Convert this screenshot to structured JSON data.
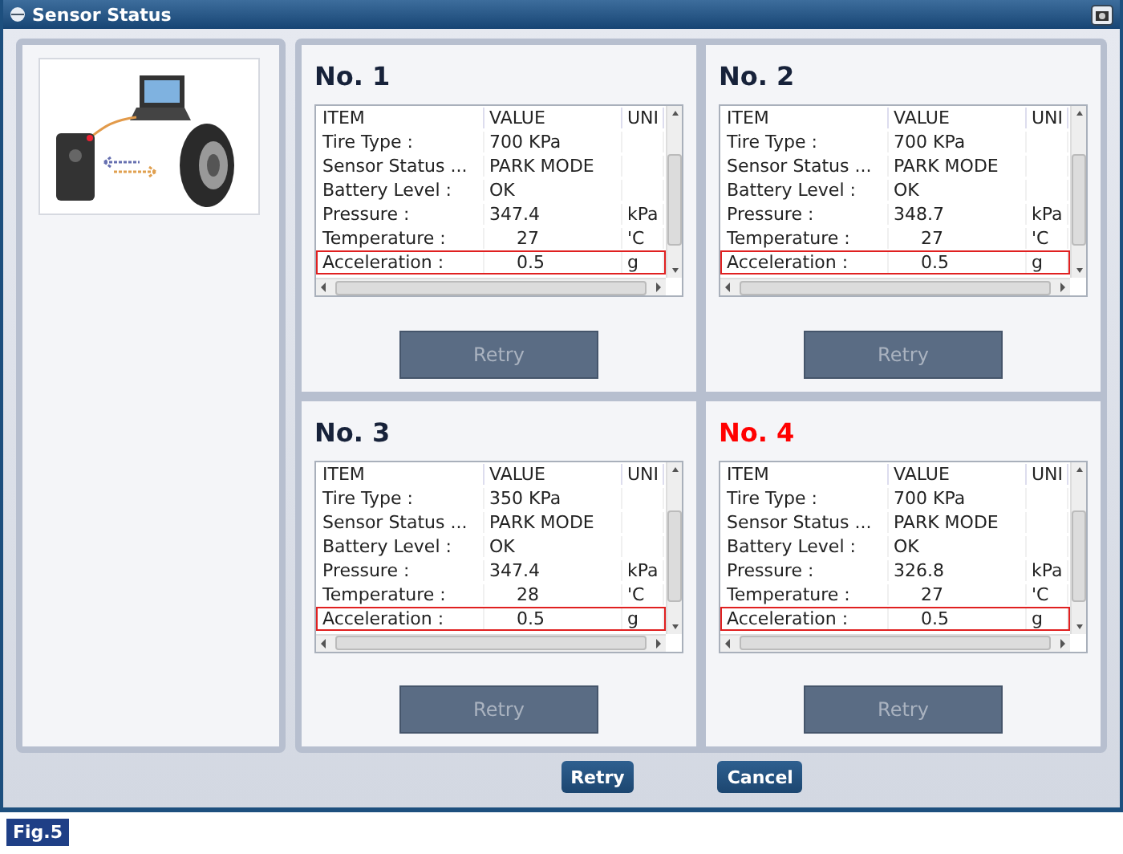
{
  "window": {
    "title": "Sensor Status"
  },
  "sensors": [
    {
      "title": "No. 1",
      "alert": false,
      "columns": [
        "ITEM",
        "VALUE",
        "UNI"
      ],
      "rows": [
        {
          "item": "Tire Type :",
          "value": "700 KPa",
          "unit": "",
          "highlighted": false
        },
        {
          "item": "Sensor Status ...",
          "value": "PARK MODE",
          "unit": "",
          "highlighted": false
        },
        {
          "item": "Battery Level :",
          "value": "OK",
          "unit": "",
          "highlighted": false
        },
        {
          "item": "Pressure :",
          "value": "347.4",
          "unit": "kPa",
          "highlighted": false
        },
        {
          "item": "Temperature :",
          "value": "27",
          "unit": "'C",
          "highlighted": false
        },
        {
          "item": "Acceleration :",
          "value": "0.5",
          "unit": "g",
          "highlighted": true
        }
      ],
      "button": {
        "label": "Retry",
        "disabled": true
      }
    },
    {
      "title": "No. 2",
      "alert": false,
      "columns": [
        "ITEM",
        "VALUE",
        "UNI"
      ],
      "rows": [
        {
          "item": "Tire Type :",
          "value": "700 KPa",
          "unit": "",
          "highlighted": false
        },
        {
          "item": "Sensor Status ...",
          "value": "PARK MODE",
          "unit": "",
          "highlighted": false
        },
        {
          "item": "Battery Level :",
          "value": "OK",
          "unit": "",
          "highlighted": false
        },
        {
          "item": "Pressure :",
          "value": "348.7",
          "unit": "kPa",
          "highlighted": false
        },
        {
          "item": "Temperature :",
          "value": "27",
          "unit": "'C",
          "highlighted": false
        },
        {
          "item": "Acceleration :",
          "value": "0.5",
          "unit": "g",
          "highlighted": true
        }
      ],
      "button": {
        "label": "Retry",
        "disabled": true
      }
    },
    {
      "title": "No. 3",
      "alert": false,
      "columns": [
        "ITEM",
        "VALUE",
        "UNI"
      ],
      "rows": [
        {
          "item": "Tire Type :",
          "value": "350 KPa",
          "unit": "",
          "highlighted": false
        },
        {
          "item": "Sensor Status ...",
          "value": "PARK MODE",
          "unit": "",
          "highlighted": false
        },
        {
          "item": "Battery Level :",
          "value": "OK",
          "unit": "",
          "highlighted": false
        },
        {
          "item": "Pressure :",
          "value": "347.4",
          "unit": "kPa",
          "highlighted": false
        },
        {
          "item": "Temperature :",
          "value": "28",
          "unit": "'C",
          "highlighted": false
        },
        {
          "item": "Acceleration :",
          "value": "0.5",
          "unit": "g",
          "highlighted": true
        }
      ],
      "button": {
        "label": "Retry",
        "disabled": true
      }
    },
    {
      "title": "No. 4",
      "alert": true,
      "columns": [
        "ITEM",
        "VALUE",
        "UNI"
      ],
      "rows": [
        {
          "item": "Tire Type :",
          "value": "700 KPa",
          "unit": "",
          "highlighted": false
        },
        {
          "item": "Sensor Status ...",
          "value": "PARK MODE",
          "unit": "",
          "highlighted": false
        },
        {
          "item": "Battery Level :",
          "value": "OK",
          "unit": "",
          "highlighted": false
        },
        {
          "item": "Pressure :",
          "value": "326.8",
          "unit": "kPa",
          "highlighted": false
        },
        {
          "item": "Temperature :",
          "value": "27",
          "unit": "'C",
          "highlighted": false
        },
        {
          "item": "Acceleration :",
          "value": "0.5",
          "unit": "g",
          "highlighted": true
        }
      ],
      "button": {
        "label": "Retry",
        "disabled": true
      }
    }
  ],
  "buttons": [
    "Retry",
    "Cancel"
  ],
  "caption": "Fig.5"
}
